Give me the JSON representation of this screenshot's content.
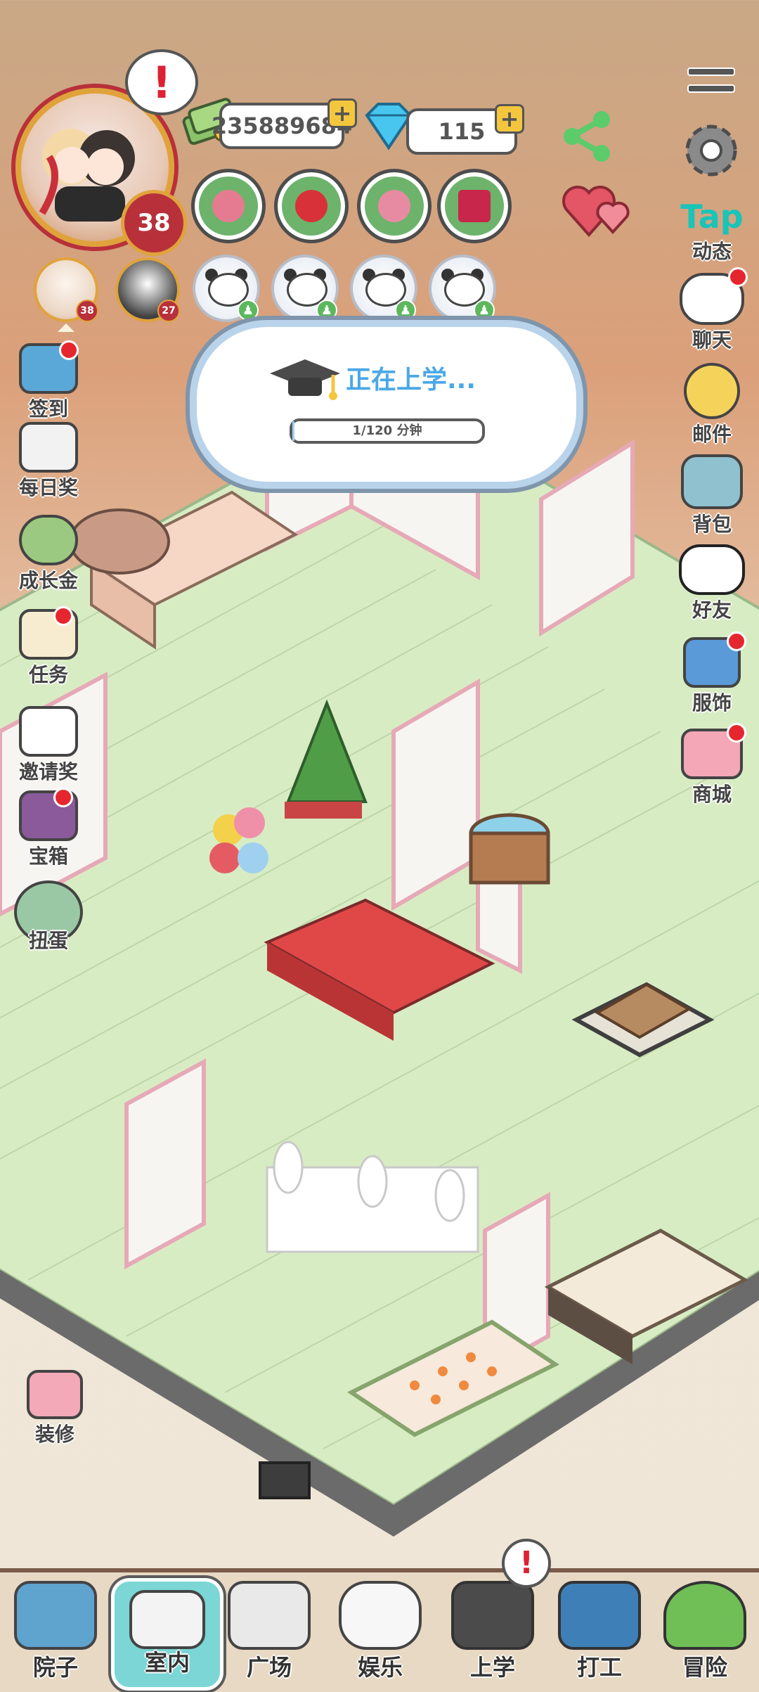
{
  "player": {
    "level": "38",
    "alert": "!",
    "coins": "235889684",
    "diamonds": "115"
  },
  "stats": [
    {
      "name": "food",
      "color": "#e57b91"
    },
    {
      "name": "heart",
      "color": "#d9313a"
    },
    {
      "name": "brain",
      "color": "#e68ba2"
    },
    {
      "name": "health",
      "color": "#c9264b"
    }
  ],
  "members": [
    {
      "level": "38"
    },
    {
      "level": "27"
    }
  ],
  "school": {
    "title": "正在上学...",
    "progress_text": "1/120 分钟",
    "progress": 0.01
  },
  "left_menu": [
    {
      "label": "签到",
      "dot": true
    },
    {
      "label": "每日奖",
      "dot": false
    },
    {
      "label": "成长金",
      "dot": false
    },
    {
      "label": "任务",
      "dot": true
    },
    {
      "label": "邀请奖",
      "dot": false
    },
    {
      "label": "宝箱",
      "dot": true
    },
    {
      "label": "扭蛋",
      "dot": false
    }
  ],
  "right_menu": [
    {
      "label": "动态",
      "brand": "Tap"
    },
    {
      "label": "聊天",
      "dot": true
    },
    {
      "label": "邮件",
      "dot": false
    },
    {
      "label": "背包",
      "dot": false
    },
    {
      "label": "好友",
      "dot": false
    },
    {
      "label": "服饰",
      "dot": true
    },
    {
      "label": "商城",
      "dot": true
    }
  ],
  "decorate": {
    "label": "装修"
  },
  "bottom_nav": [
    {
      "label": "院子",
      "active": false
    },
    {
      "label": "室内",
      "active": true
    },
    {
      "label": "广场",
      "active": false
    },
    {
      "label": "娱乐",
      "active": false
    },
    {
      "label": "上学",
      "active": false,
      "alert": "!"
    },
    {
      "label": "打工",
      "active": false
    },
    {
      "label": "冒险",
      "active": false
    }
  ],
  "colors": {
    "accent": "#4aa8e6",
    "grass": "#6db36b",
    "alert_red": "#e6262e"
  }
}
